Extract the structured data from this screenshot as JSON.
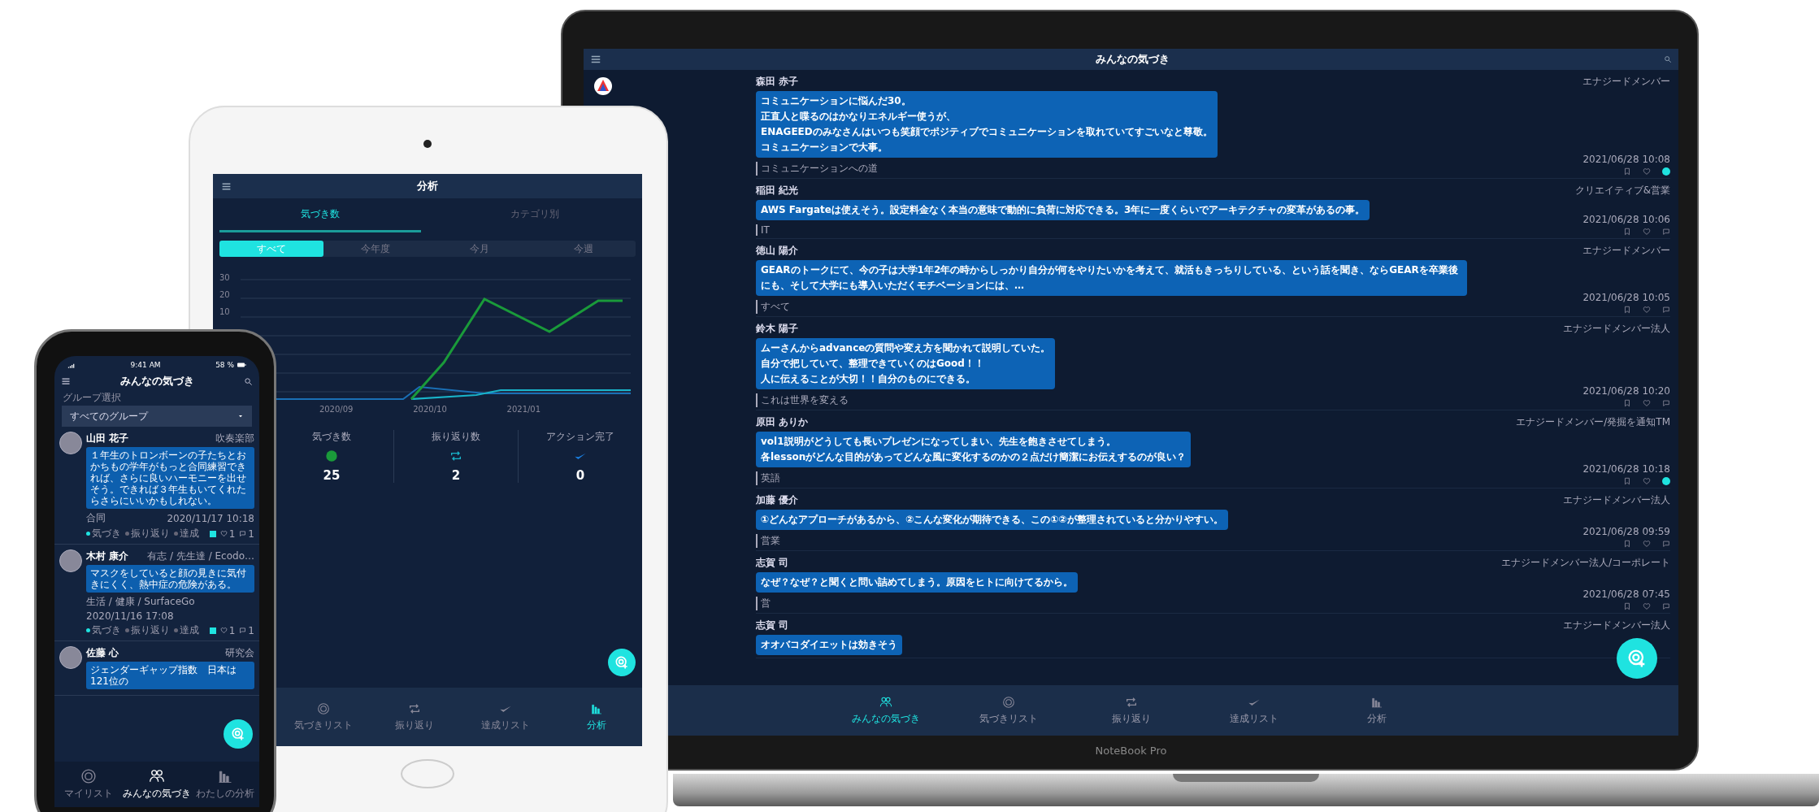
{
  "laptop": {
    "title": "みんなの気づき",
    "brand_label": "NoteBook Pro",
    "posts": [
      {
        "author": "森田 赤子",
        "group": "エナジードメンバー",
        "lines": [
          "コミュニケーションに悩んだ30。",
          "正直人と喋るのはかなりエネルギー使うが、",
          "ENAGEEDのみなさんはいつも笑顔でポジティブでコミュニケーションを取れていてすごいなと尊敬。",
          "コミュニケーションで大事。"
        ],
        "tag": "コミュニケーションへの道",
        "date": "2021/06/28 10:08",
        "reacted": true
      },
      {
        "author": "稲田 紀光",
        "group": "クリエイティブ&営業",
        "lines": [
          "AWS Fargateは使えそう。設定料金なく本当の意味で動的に負荷に対応できる。3年に一度くらいでアーキテクチャの変革があるの事。"
        ],
        "tag": "IT",
        "date": "2021/06/28 10:06",
        "reacted": false
      },
      {
        "author": "徳山 陽介",
        "group": "エナジードメンバー",
        "lines": [
          "GEARのトークにて、今の子は大学1年2年の時からしっかり自分が何をやりたいかを考えて、就活もきっちりしている、という話を聞き、ならGEARを卒業後にも、そして大学にも導入いただくモチベーションには、…"
        ],
        "tag": "すべて",
        "date": "2021/06/28 10:05",
        "reacted": false
      },
      {
        "author": "鈴木 陽子",
        "group": "エナジードメンバー法人",
        "lines": [
          "ムーさんからadvanceの質問や変え方を聞かれて説明していた。",
          "自分で把していて、整理できていくのはGood！！",
          "人に伝えることが大切！！自分のものにできる。"
        ],
        "tag": "これは世界を変える",
        "date": "2021/06/28 10:20",
        "reacted": false
      },
      {
        "author": "原田 ありか",
        "group": "エナジードメンバー/発掘を通知TM",
        "lines": [
          "vol1説明がどうしても長いプレゼンになってしまい、先生を飽きさせてしまう。",
          "各lessonがどんな目的があってどんな風に変化するのかの２点だけ簡潔にお伝えするのが良い？"
        ],
        "tag": "英語",
        "date": "2021/06/28 10:18",
        "reacted": true
      },
      {
        "author": "加藤 優介",
        "group": "エナジードメンバー法人",
        "lines": [
          "①どんなアプローチがあるから、②こんな変化が期待できる、この①②が整理されていると分かりやすい。"
        ],
        "tag": "営業",
        "date": "2021/06/28 09:59",
        "reacted": false
      },
      {
        "author": "志賀 司",
        "group": "エナジードメンバー法人/コーポレート",
        "lines": [
          "なぜ？なぜ？と聞くと問い詰めてしまう。原因をヒトに向けてるから。"
        ],
        "tag": "営",
        "date": "2021/06/28 07:45",
        "reacted": false
      },
      {
        "author": "志賀 司",
        "group": "エナジードメンバー法人",
        "lines": [
          "オオバコダイエットは効きそう"
        ]
      }
    ],
    "nav": [
      {
        "kind": "people",
        "label": "みんなの気づき",
        "selected": true
      },
      {
        "kind": "target",
        "label": "気づきリスト",
        "selected": false
      },
      {
        "kind": "repeat",
        "label": "振り返り",
        "selected": false
      },
      {
        "kind": "check",
        "label": "達成リスト",
        "selected": false
      },
      {
        "kind": "chart",
        "label": "分析",
        "selected": false
      }
    ]
  },
  "tablet": {
    "title": "分析",
    "tabs": [
      {
        "label": "気づき数",
        "selected": true
      },
      {
        "label": "カテゴリ別",
        "selected": false
      }
    ],
    "periods": [
      {
        "label": "すべて",
        "selected": true
      },
      {
        "label": "今年度",
        "selected": false
      },
      {
        "label": "今月",
        "selected": false
      },
      {
        "label": "今週",
        "selected": false
      }
    ],
    "y_labels": [
      "30",
      "20",
      "10"
    ],
    "x_labels": [
      "2020/09",
      "2020/10",
      "2021/01"
    ],
    "stats": [
      {
        "kind": "dot",
        "label": "気づき数",
        "value": "25"
      },
      {
        "kind": "repeat",
        "label": "振り返り数",
        "value": "2"
      },
      {
        "kind": "check",
        "label": "アクション完了",
        "value": "0"
      }
    ],
    "nav": [
      {
        "kind": "target",
        "label": "気づきリスト",
        "selected": false
      },
      {
        "kind": "repeat",
        "label": "振り返り",
        "selected": false
      },
      {
        "kind": "check",
        "label": "達成リスト",
        "selected": false
      },
      {
        "kind": "chart",
        "label": "分析",
        "selected": true
      }
    ]
  },
  "phone": {
    "time": "9:41 AM",
    "battery": "58 %",
    "title": "みんなの気づき",
    "group_label": "グループ選択",
    "group_value": "すべてのグループ",
    "posts": [
      {
        "author": "山田 花子",
        "group": "吹奏楽部",
        "text": "１年生のトロンボーンの子たちとおかちもの学年がもっと合同練習できれば、さらに良いハーモニーを出せそう。できれば３年生もいてくれたらさらにいいかもしれない。",
        "tag": "合同",
        "date": "2020/11/17 10:18",
        "steps": [
          {
            "label": "気づき",
            "done": true
          },
          {
            "label": "振り返り",
            "done": false
          },
          {
            "label": "達成",
            "done": false
          }
        ],
        "likes": "1",
        "comments": "1"
      },
      {
        "author": "木村 康介",
        "group": "有志 / 先生達 / Ecodo…",
        "text": "マスクをしていると顔の見きに気付きにくく、熱中症の危険がある。",
        "tag": "生活 / 健康 / SurfaceGo",
        "date": "2020/11/16 17:08",
        "steps": [
          {
            "label": "気づき",
            "done": true
          },
          {
            "label": "振り返り",
            "done": false
          },
          {
            "label": "達成",
            "done": false
          }
        ],
        "likes": "1",
        "comments": "1"
      },
      {
        "author": "佐藤 心",
        "group": "研究会",
        "text": "ジェンダーギャップ指数　日本は121位の"
      }
    ],
    "nav": [
      {
        "kind": "target",
        "label": "マイリスト",
        "selected": false
      },
      {
        "kind": "people",
        "label": "みんなの気づき",
        "selected": true
      },
      {
        "kind": "chart",
        "label": "わたしの分析",
        "selected": false
      }
    ]
  }
}
